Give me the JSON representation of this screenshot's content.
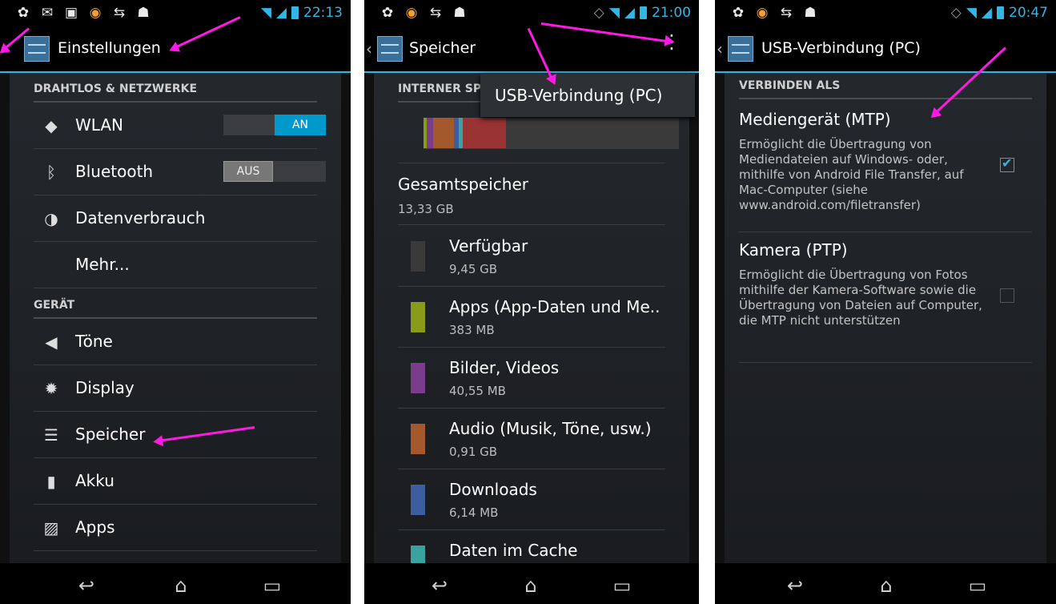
{
  "colors": {
    "accent": "#33b5e5",
    "arrow": "#ff19e6",
    "toggle_on": "#0099cc"
  },
  "panel1": {
    "status_time": "22:13",
    "title": "Einstellungen",
    "section_wireless": "DRAHTLOS & NETZWERKE",
    "wlan_label": "WLAN",
    "wlan_toggle": "AN",
    "bluetooth_label": "Bluetooth",
    "bluetooth_toggle": "AUS",
    "data_label": "Datenverbrauch",
    "more_label": "Mehr...",
    "section_device": "GERÄT",
    "sound_label": "Töne",
    "display_label": "Display",
    "storage_label": "Speicher",
    "battery_label": "Akku",
    "apps_label": "Apps"
  },
  "panel2": {
    "status_time": "21:00",
    "title": "Speicher",
    "section_internal": "INTERNER SP",
    "menu_popup": "USB-Verbindung (PC)",
    "total_title": "Gesamtspeicher",
    "total_value": "13,33 GB",
    "items": [
      {
        "title": "Verfügbar",
        "value": "9,45 GB",
        "color": "#3a3a3a"
      },
      {
        "title": "Apps (App-Daten und Me..",
        "value": "383 MB",
        "color": "#8a9a1b"
      },
      {
        "title": "Bilder, Videos",
        "value": "40,55 MB",
        "color": "#7a3d8c"
      },
      {
        "title": "Audio (Musik, Töne, usw.)",
        "value": "0,91 GB",
        "color": "#a3592b"
      },
      {
        "title": "Downloads",
        "value": "6,14 MB",
        "color": "#3d5e9e"
      },
      {
        "title": "Daten im Cache",
        "value": "",
        "color": "#3aa3a0"
      }
    ]
  },
  "panel3": {
    "status_time": "20:47",
    "title": "USB-Verbindung (PC)",
    "section_connect": "VERBINDEN ALS",
    "mtp_title": "Mediengerät (MTP)",
    "mtp_desc": "Ermöglicht die Übertragung von Mediendateien auf Windows- oder, mithilfe von Android File Transfer, auf Mac-Computer (siehe www.android.com/filetransfer)",
    "mtp_checked": true,
    "ptp_title": "Kamera (PTP)",
    "ptp_desc": "Ermöglicht die Übertragung von Fotos mithilfe der Kamera-Software sowie die Übertragung von Dateien auf Computer, die MTP nicht unterstützen",
    "ptp_checked": false
  }
}
